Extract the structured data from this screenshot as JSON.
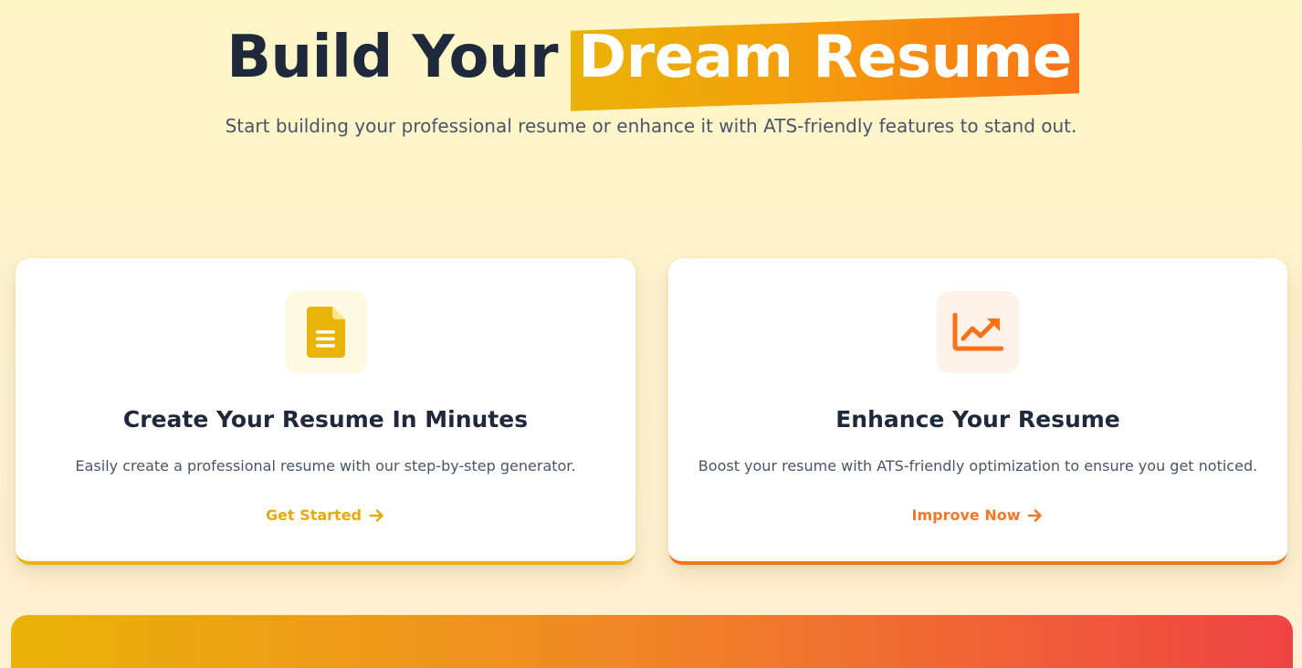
{
  "hero": {
    "title_plain": "Build Your",
    "title_highlight": "Dream Resume",
    "subtitle": "Start building your professional resume or enhance it with ATS-friendly features to stand out."
  },
  "cards": [
    {
      "icon": "document-icon",
      "title": "Create Your Resume In Minutes",
      "description": "Easily create a professional resume with our step-by-step generator.",
      "link_label": "Get Started",
      "accent": "#eab308"
    },
    {
      "icon": "chart-line-icon",
      "title": "Enhance Your Resume",
      "description": "Boost your resume with ATS-friendly optimization to ensure you get noticed.",
      "link_label": "Improve Now",
      "accent": "#f97316"
    }
  ],
  "colors": {
    "background": "#fef7c6",
    "heading": "#1e293b",
    "highlight_start": "#eab308",
    "highlight_end": "#f97316",
    "banner_end": "#ef4444"
  }
}
